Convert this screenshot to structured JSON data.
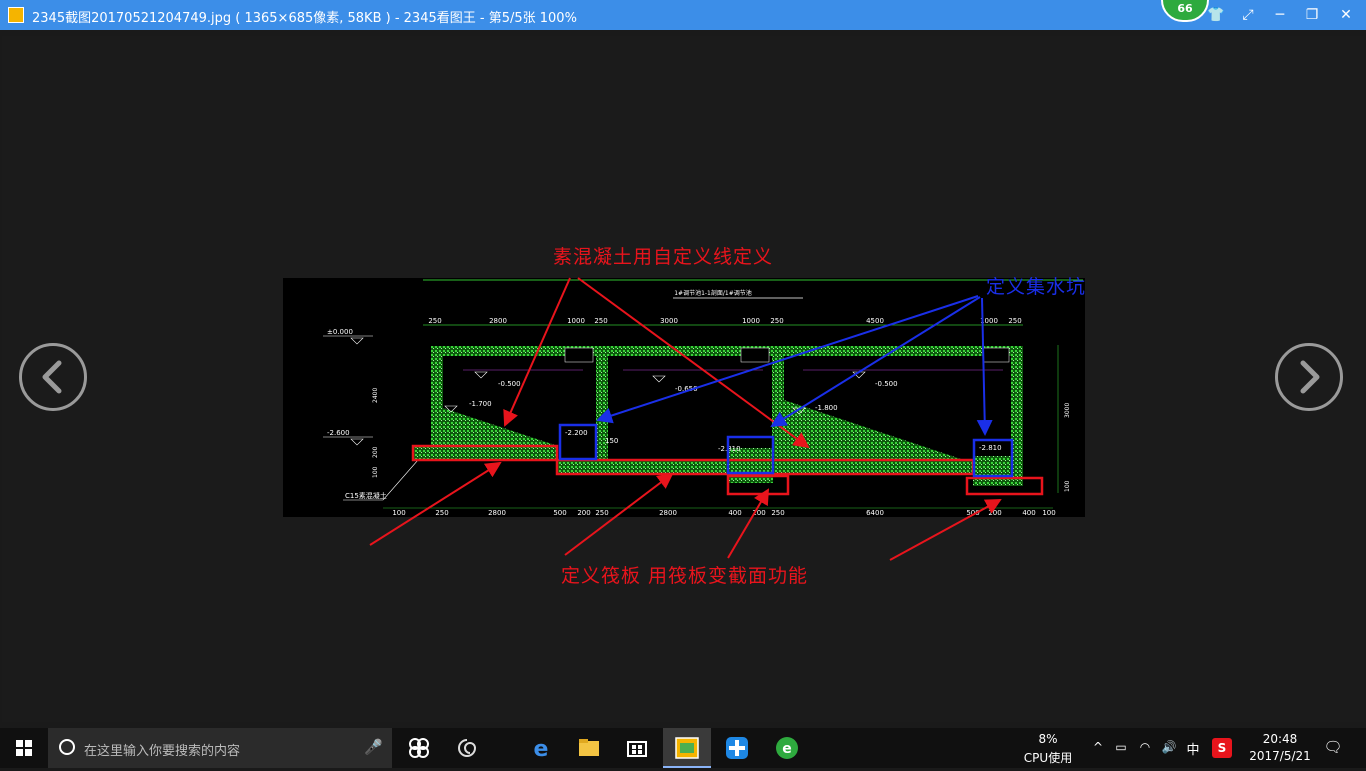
{
  "window": {
    "title": "2345截图20170521204749.jpg ( 1365×685像素, 58KB ) - 2345看图王 - 第5/5张 100%",
    "badge_count": "66",
    "buttons": {
      "skin": "👕",
      "fullscreen": "⤢",
      "minimize": "─",
      "restore": "❐",
      "close": "✕"
    }
  },
  "annotations": {
    "concrete": "素混凝土用自定义线定义",
    "sump": "定义集水坑",
    "raft": "定义筏板 用筏板变截面功能"
  },
  "drawing": {
    "title": "1#调节池1-1剖面/1#调节池",
    "dims_top": [
      "250",
      "2800",
      "1000",
      "250",
      "3000",
      "1000",
      "250",
      "4500",
      "1000",
      "250"
    ],
    "dims_bottom": [
      "100",
      "250",
      "2800",
      "500",
      "200",
      "250",
      "2800",
      "400",
      "200",
      "250",
      "6400",
      "500",
      "200",
      "400",
      "100"
    ],
    "elevations": [
      "±0.000",
      "-2.600",
      "-0.500",
      "-0.650",
      "-0.500",
      "-1.700",
      "-1.800",
      "-2.200",
      "-2.810",
      "-2.810"
    ],
    "side_dims": [
      "2400",
      "200",
      "100",
      "3000",
      "100"
    ],
    "label_c15": "C15素混凝土",
    "label_150": "150"
  },
  "taskbar": {
    "search_placeholder": "在这里输入你要搜索的内容",
    "cpu_percent": "8%",
    "cpu_label": "CPU使用",
    "ime": "中",
    "time": "20:48",
    "date": "2017/5/21"
  },
  "colors": {
    "titlebar": "#3c8ee8",
    "accent_red": "#e8141c",
    "accent_blue": "#1a2fe8",
    "cad_green": "#2fbf2f"
  }
}
